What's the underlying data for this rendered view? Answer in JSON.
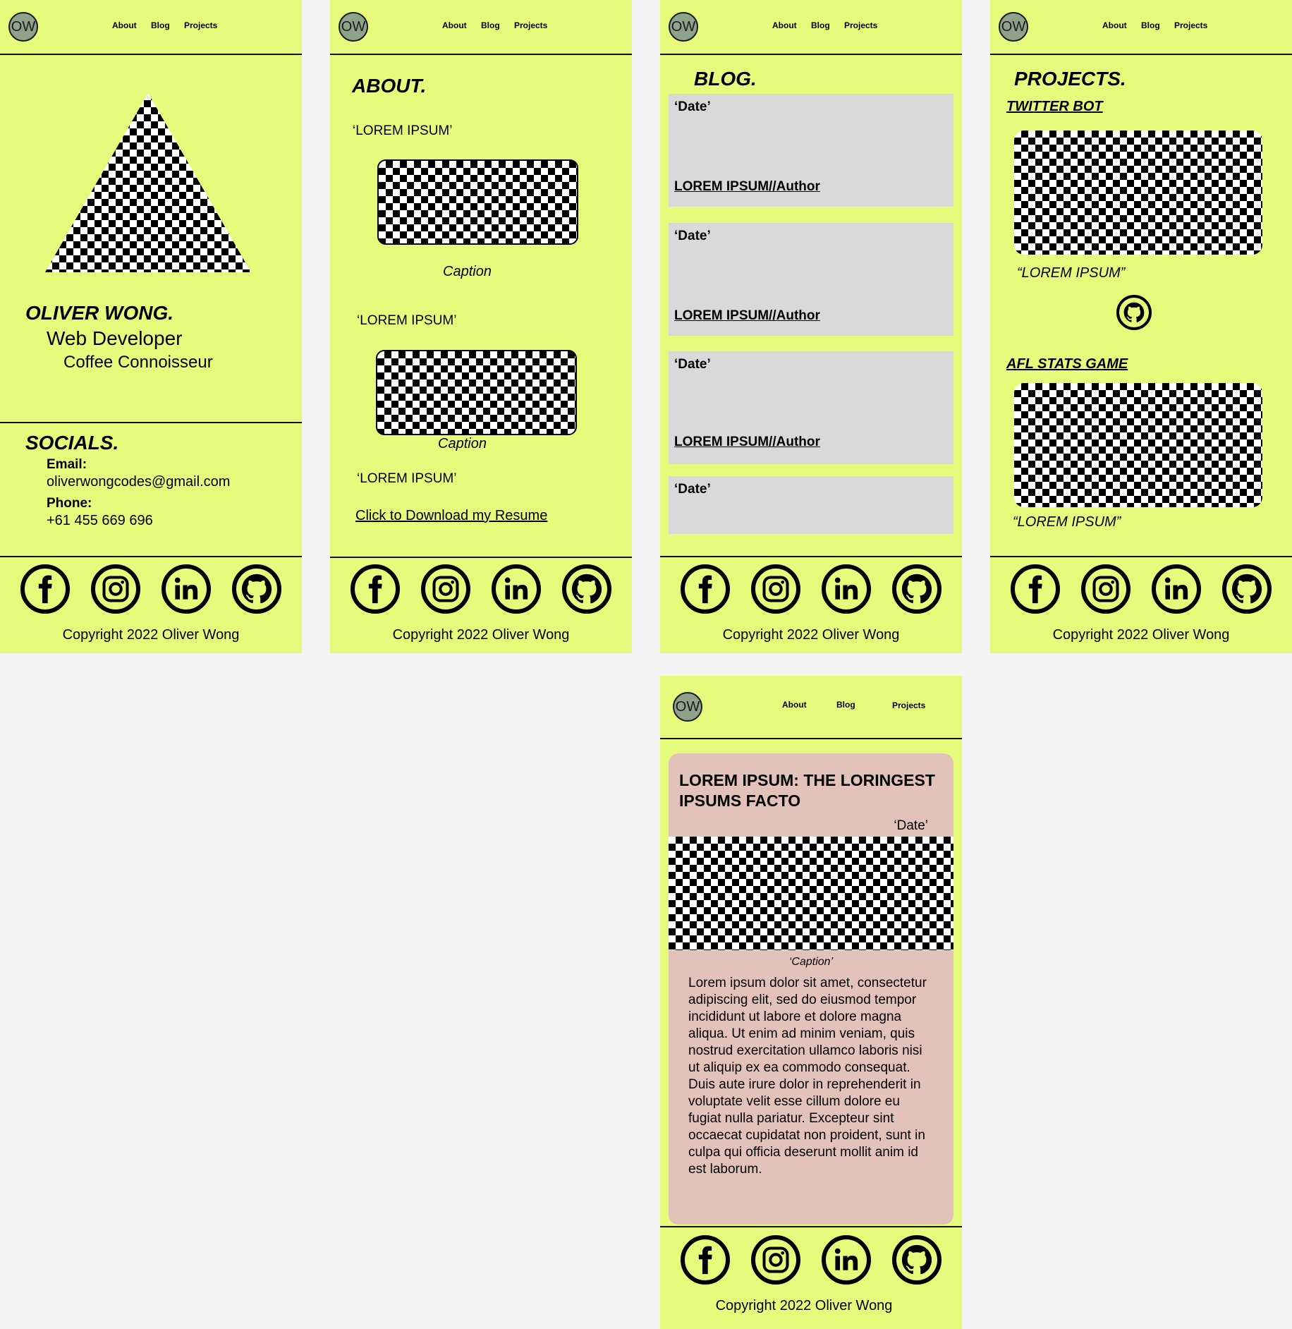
{
  "nav": {
    "logo": "OW",
    "about": "About",
    "blog": "Blog",
    "projects": "Projects"
  },
  "home": {
    "name": "OLIVER WONG.",
    "role": "Web Developer",
    "hobby": "Coffee Connoisseur",
    "socials_title": "SOCIALS.",
    "email_label": "Email:",
    "email": "oliverwongcodes@gmail.com",
    "phone_label": "Phone:",
    "phone": "+61 455 669 696"
  },
  "about": {
    "title": "ABOUT.",
    "item1": "‘LOREM IPSUM’",
    "caption1": "Caption",
    "item2": "‘LOREM IPSUM’",
    "caption2": "Caption",
    "item3": "‘LOREM IPSUM’",
    "resume_link": "Click to Download my Resume"
  },
  "blog": {
    "title": "BLOG.",
    "cards": [
      {
        "date": "‘Date’",
        "author": "LOREM IPSUM//Author"
      },
      {
        "date": "‘Date’",
        "author": "LOREM IPSUM//Author"
      },
      {
        "date": "‘Date’",
        "author": "LOREM IPSUM//Author"
      },
      {
        "date": "‘Date’",
        "author": ""
      }
    ]
  },
  "projects": {
    "title": "PROJECTS.",
    "p1_title": "TWITTER BOT",
    "p1_quote": "“LOREM IPSUM”",
    "p2_title": "AFL STATS GAME",
    "p2_quote": "“LOREM IPSUM”"
  },
  "post": {
    "title": "LOREM IPSUM: THE LORINGEST IPSUMS FACTO",
    "date": "‘Date’",
    "caption": "‘Caption’",
    "body": "Lorem ipsum dolor sit amet, consectetur adipiscing elit, sed do eiusmod tempor incididunt ut labore et dolore magna aliqua. Ut enim ad minim veniam, quis nostrud exercitation ullamco laboris nisi ut aliquip ex ea commodo consequat. Duis aute irure dolor in reprehenderit in voluptate velit esse cillum dolore eu fugiat nulla pariatur. Excepteur sint occaecat cupidatat non proident, sunt in culpa qui officia deserunt mollit anim id est laborum."
  },
  "footer": {
    "copyright": "Copyright 2022 Oliver Wong"
  },
  "icons": [
    "facebook-icon",
    "instagram-icon",
    "linkedin-icon",
    "github-icon"
  ],
  "colors": {
    "background": "#e6fa7c",
    "card": "#d9d9d9",
    "post_card": "#e2c2b9",
    "logo": "#8fa38a",
    "page": "#f4f4f4"
  }
}
